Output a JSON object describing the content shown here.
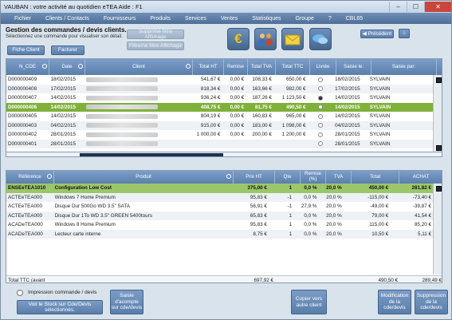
{
  "window": {
    "title": "VAUBAN : votre activité au quotidien eTEA Aide : F1"
  },
  "menu": [
    "Fichier",
    "Clients / Contacts",
    "Fournisseurs",
    "Produits",
    "Services",
    "Ventes",
    "Statistiques",
    "Groupe",
    "?",
    "CBL65"
  ],
  "header": {
    "title": "Gestion des commandes / devis clients.",
    "subtitle": "Sélectionnez une commande pour visualiser son détail."
  },
  "buttons": {
    "fiche_client": "Fiche Client",
    "facturer": "Facturer",
    "suppr_filtre": "Supprime filtre Affichage",
    "filtre": "Filtre/ne filtre Affichage",
    "precedent": "Précédent"
  },
  "orders": {
    "columns": [
      "N_CDE",
      "Date",
      "Client",
      "Total HT",
      "Remise",
      "Total TVA",
      "Total TTC",
      "Livrée",
      "Saisie le:",
      "Saisie par:"
    ],
    "rows": [
      {
        "n": "D000000409",
        "date": "18/02/2015",
        "client": "xxxxxxxx",
        "ht": "541,67 €",
        "remise": "0,00 €",
        "tva": "108,33 €",
        "ttc": "650,00 €",
        "livree": false,
        "saisie": "18/02/2015",
        "par": "SYLVAIN"
      },
      {
        "n": "D000000408",
        "date": "17/02/2015",
        "client": "xxxxxxxx",
        "ht": "818,34 €",
        "remise": "0,00 €",
        "tva": "163,66 €",
        "ttc": "982,00 €",
        "livree": false,
        "saisie": "17/02/2015",
        "par": "SYLVAIN"
      },
      {
        "n": "D000000407",
        "date": "14/02/2015",
        "client": "xxxxxxxx",
        "ht": "936,24 €",
        "remise": "0,00 €",
        "tva": "187,26 €",
        "ttc": "1 123,50 €",
        "livree": true,
        "saisie": "14/02/2015",
        "par": "SYLVAIN"
      },
      {
        "n": "D000000406",
        "date": "14/02/2015",
        "client": "xxxxxxxx",
        "ht": "408,75 €",
        "remise": "0,00 €",
        "tva": "81,75 €",
        "ttc": "490,50 €",
        "livree": false,
        "saisie": "14/02/2015",
        "par": "SYLVAIN"
      },
      {
        "n": "D000000405",
        "date": "14/02/2015",
        "client": "xxxxxxxx",
        "ht": "804,19 €",
        "remise": "0,00 €",
        "tva": "160,83 €",
        "ttc": "965,00 €",
        "livree": false,
        "saisie": "14/02/2015",
        "par": "SYLVAIN"
      },
      {
        "n": "D000000403",
        "date": "04/02/2015",
        "client": "xxxxxxxx",
        "ht": "915,00 €",
        "remise": "0,00 €",
        "tva": "183,00 €",
        "ttc": "1 098,00 €",
        "livree": false,
        "saisie": "04/02/2015",
        "par": "SYLVAIN"
      },
      {
        "n": "D000000402",
        "date": "28/01/2015",
        "client": "xxxxxxxx",
        "ht": "1 000,00 €",
        "remise": "0,00 €",
        "tva": "200,00 €",
        "ttc": "1 200,00 €",
        "livree": false,
        "saisie": "28/01/2015",
        "par": "SYLVAIN"
      },
      {
        "n": "D000000401",
        "date": "28/01/2015",
        "client": "xxxxxxxx",
        "ht": "",
        "remise": "",
        "tva": "",
        "ttc": "",
        "livree": false,
        "saisie": "28/01/2015",
        "par": "SYLVAIN"
      }
    ]
  },
  "details": {
    "columns": [
      "Référence",
      "Produit",
      "Prix HT",
      "Qte",
      "Remise (%)",
      "TVA",
      "Total",
      "ACHAT"
    ],
    "rows": [
      {
        "ref": "ENSEeTEA1010",
        "prod": "Configuration Low Cost",
        "prix": "375,00 €",
        "qte": "1",
        "remise": "0,0 %",
        "tva": "20,0 %",
        "total": "450,00 €",
        "achat": "281,82 €",
        "hl": true
      },
      {
        "ref": "ACTEeTEA000",
        "prod": "Windows 7 Home Premium",
        "prix": "95,83 €",
        "qte": "-1",
        "remise": "0,0 %",
        "tva": "20,0 %",
        "total": "-115,00 €",
        "achat": "-73,40 €"
      },
      {
        "ref": "ACTEeTEA000",
        "prod": "Disque Dur 500Go WD 3.5\" SATA",
        "prix": "56,91 €",
        "qte": "-1",
        "remise": "27,9 %",
        "tva": "20,0 %",
        "total": "-49,00 €",
        "achat": "-39,87 €"
      },
      {
        "ref": "ACTEeTEA000",
        "prod": "Disque Dur 1To WD 3.5\" GREEN 5400tours",
        "prix": "65,83 €",
        "qte": "1",
        "remise": "0,0 %",
        "tva": "20,0 %",
        "total": "79,00 €",
        "achat": "41,54 €"
      },
      {
        "ref": "ACADeTEA000",
        "prod": "Windows 8 Home Premium",
        "prix": "95,83 €",
        "qte": "1",
        "remise": "0,0 %",
        "tva": "20,0 %",
        "total": "115,00 €",
        "achat": "85,20 €"
      },
      {
        "ref": "ACADeTEA000",
        "prod": "Lecteur carte interne",
        "prix": "8,75 €",
        "qte": "1",
        "remise": "0,0 %",
        "tva": "20,0 %",
        "total": "10,50 €",
        "achat": "5,11 €"
      }
    ],
    "footer": {
      "label": "Total TTC (avant",
      "prix": "697,92 €",
      "total": "490,50 €",
      "achat": "289,49 €"
    }
  },
  "bottom": {
    "impression": "Impression commande / devis",
    "voir_stock": "Voir le Stock sur Cde/Devis sélectionnés.",
    "saisie_acompte": "Saisie d'acompte sur cde/devis",
    "copier": "Copier vers autre client",
    "modif": "Modification de la cde/devis",
    "suppr": "Suppression de la cde/devis"
  }
}
